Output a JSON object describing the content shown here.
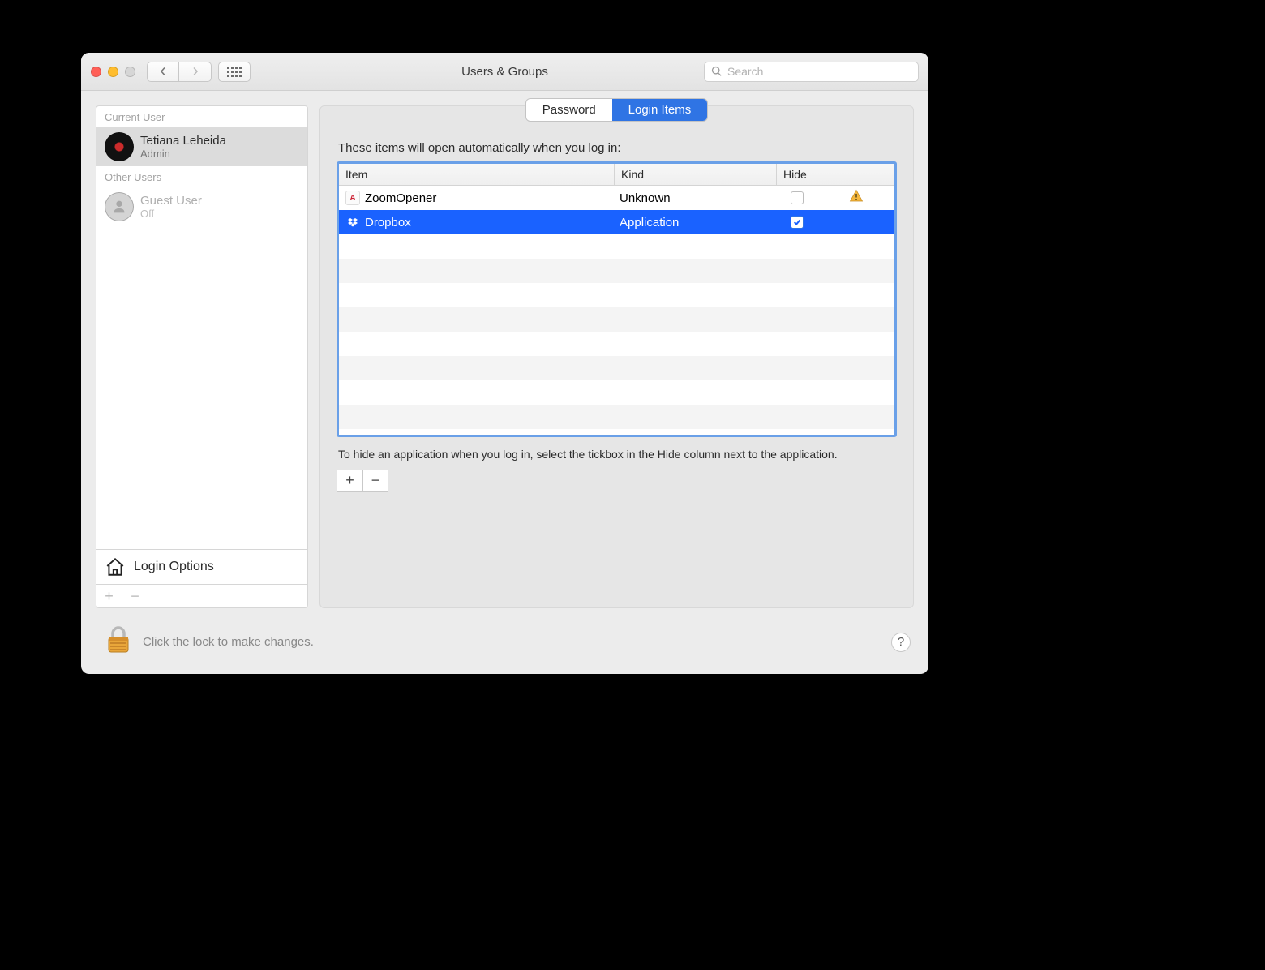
{
  "window": {
    "title": "Users & Groups"
  },
  "search": {
    "placeholder": "Search"
  },
  "sidebar": {
    "headers": {
      "current": "Current User",
      "other": "Other Users"
    },
    "current_user": {
      "name": "Tetiana Leheida",
      "role": "Admin"
    },
    "guest": {
      "name": "Guest User",
      "status": "Off"
    },
    "login_options_label": "Login Options"
  },
  "tabs": {
    "password": "Password",
    "login_items": "Login Items"
  },
  "panel": {
    "intro": "These items will open automatically when you log in:",
    "columns": {
      "item": "Item",
      "kind": "Kind",
      "hide": "Hide"
    },
    "rows": [
      {
        "name": "ZoomOpener",
        "kind": "Unknown",
        "hide": false,
        "warn": true,
        "icon": "zoom",
        "selected": false
      },
      {
        "name": "Dropbox",
        "kind": "Application",
        "hide": true,
        "warn": false,
        "icon": "dropbox",
        "selected": true
      }
    ],
    "hint": "To hide an application when you log in, select the tickbox in the Hide column next to the application."
  },
  "lock_text": "Click the lock to make changes."
}
